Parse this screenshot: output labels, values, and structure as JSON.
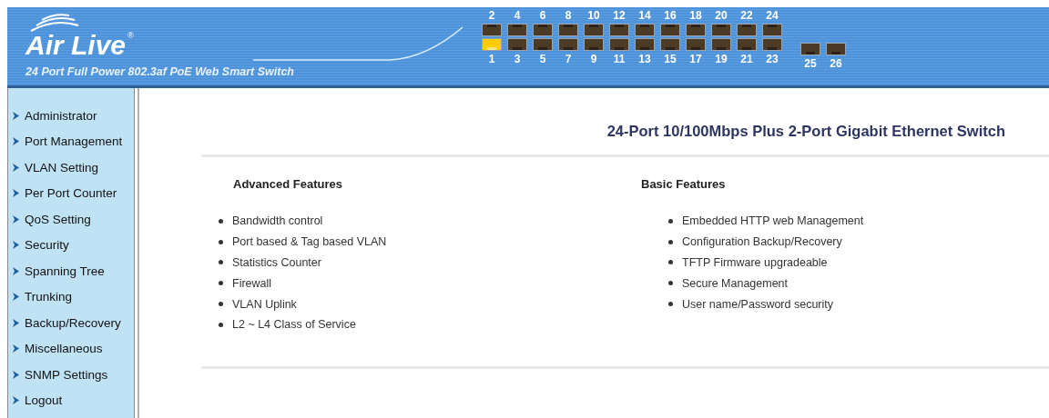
{
  "header": {
    "logo": "Air Live",
    "logo_mark": "®",
    "subtitle": "24 Port Full Power 802.3af PoE Web Smart Switch"
  },
  "ports": {
    "top": [
      {
        "label": "2",
        "active": false
      },
      {
        "label": "4",
        "active": false
      },
      {
        "label": "6",
        "active": false
      },
      {
        "label": "8",
        "active": false
      },
      {
        "label": "10",
        "active": false
      },
      {
        "label": "12",
        "active": false
      },
      {
        "label": "14",
        "active": false
      },
      {
        "label": "16",
        "active": false
      },
      {
        "label": "18",
        "active": false
      },
      {
        "label": "20",
        "active": false
      },
      {
        "label": "22",
        "active": false
      },
      {
        "label": "24",
        "active": false
      }
    ],
    "bottom": [
      {
        "label": "1",
        "active": true
      },
      {
        "label": "3",
        "active": false
      },
      {
        "label": "5",
        "active": false
      },
      {
        "label": "7",
        "active": false
      },
      {
        "label": "9",
        "active": false
      },
      {
        "label": "11",
        "active": false
      },
      {
        "label": "13",
        "active": false
      },
      {
        "label": "15",
        "active": false
      },
      {
        "label": "17",
        "active": false
      },
      {
        "label": "19",
        "active": false
      },
      {
        "label": "21",
        "active": false
      },
      {
        "label": "23",
        "active": false
      }
    ],
    "uplinks": [
      {
        "label": "25",
        "active": false
      },
      {
        "label": "26",
        "active": false
      }
    ]
  },
  "sidebar": {
    "items": [
      "Administrator",
      "Port Management",
      "VLAN Setting",
      "Per Port Counter",
      "QoS Setting",
      "Security",
      "Spanning Tree",
      "Trunking",
      "Backup/Recovery",
      "Miscellaneous",
      "SNMP Settings",
      "Logout"
    ]
  },
  "content": {
    "title": "24-Port 10/100Mbps Plus 2-Port Gigabit Ethernet Switch",
    "columns": [
      {
        "heading": "Advanced Features",
        "items": [
          "Bandwidth control",
          "Port based & Tag based VLAN",
          "Statistics Counter",
          "Firewall",
          "VLAN Uplink",
          "L2 ~ L4 Class of Service"
        ]
      },
      {
        "heading": "Basic Features",
        "items": [
          "Embedded HTTP web Management",
          "Configuration Backup/Recovery",
          "TFTP Firmware upgradeable",
          "Secure Management",
          "User name/Password security"
        ]
      }
    ]
  }
}
